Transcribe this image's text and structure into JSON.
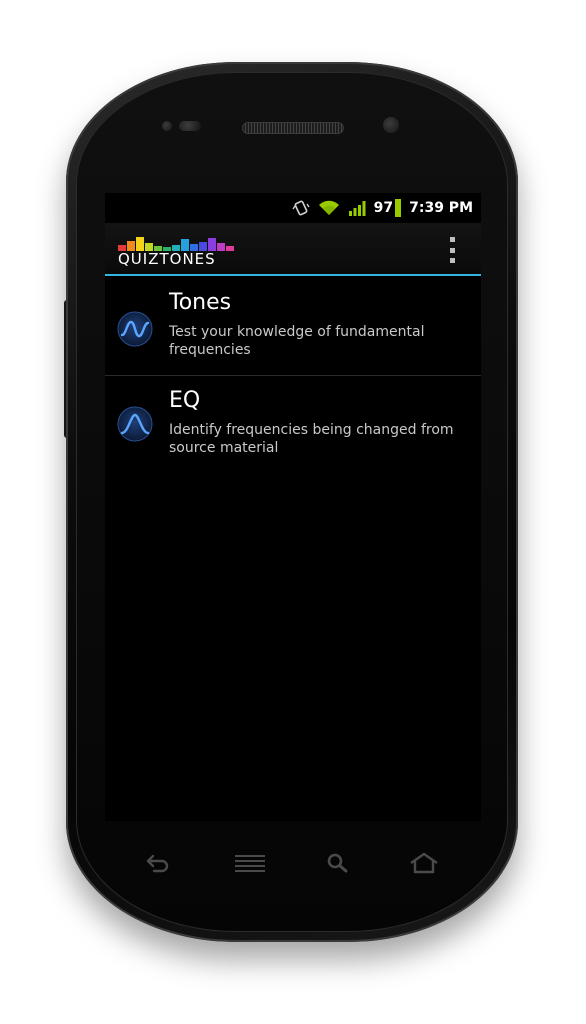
{
  "status_bar": {
    "battery_level": "97",
    "time": "7:39 PM",
    "icons": [
      "vibrate-icon",
      "wifi-icon",
      "signal-icon",
      "battery-icon"
    ],
    "accent_color": "#99cc00"
  },
  "action_bar": {
    "logo_text": "QUIZTONES",
    "overflow_icon": "overflow-menu-icon",
    "divider_color": "#33b5e5"
  },
  "list": {
    "items": [
      {
        "title": "Tones",
        "subtitle": "Test your knowledge of fundamental frequencies",
        "icon": "sine-wave-icon"
      },
      {
        "title": "EQ",
        "subtitle": "Identify frequencies being changed from source material",
        "icon": "eq-peak-icon"
      }
    ]
  },
  "nav_bar": {
    "buttons": [
      "back-icon",
      "menu-icon",
      "search-icon",
      "home-icon"
    ]
  }
}
